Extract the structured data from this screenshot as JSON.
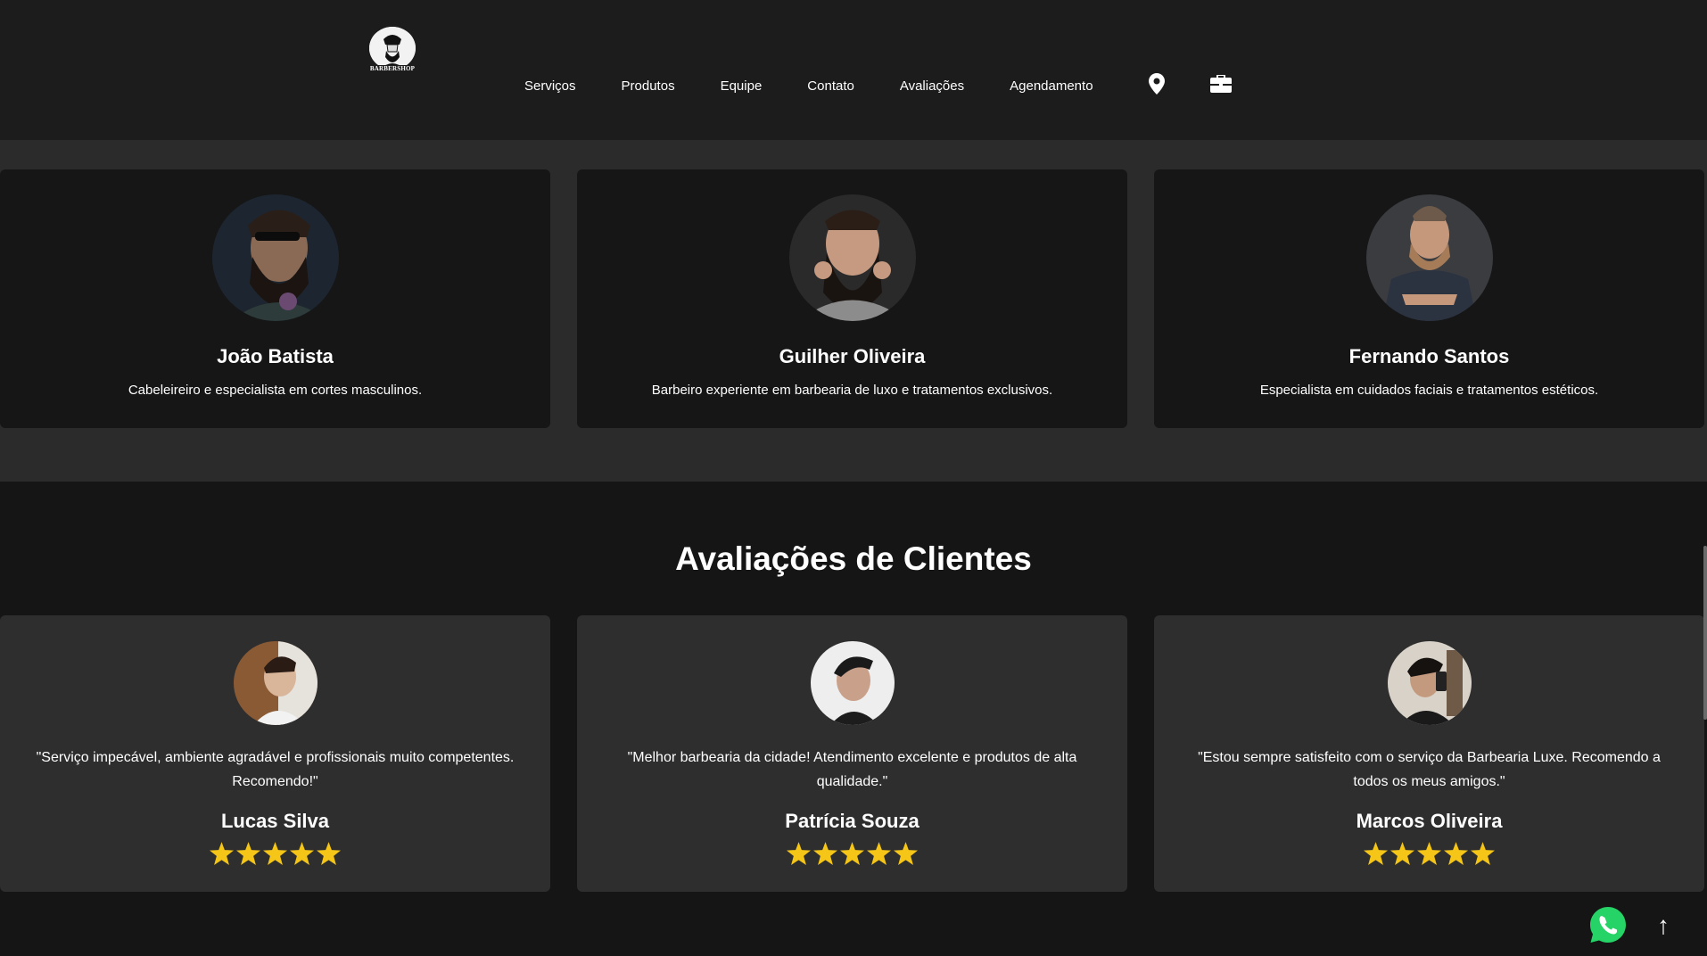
{
  "header": {
    "logo_text": "BARBERSHOP",
    "nav": [
      "Serviços",
      "Produtos",
      "Equipe",
      "Contato",
      "Avaliações",
      "Agendamento"
    ],
    "icons": [
      "map-marker-icon",
      "briefcase-icon"
    ]
  },
  "team": [
    {
      "name": "João Batista",
      "desc": "Cabeleireiro e especialista em cortes masculinos."
    },
    {
      "name": "Guilher Oliveira",
      "desc": "Barbeiro experiente em barbearia de luxo e tratamentos exclusivos."
    },
    {
      "name": "Fernando Santos",
      "desc": "Especialista em cuidados faciais e tratamentos estéticos."
    }
  ],
  "reviews": {
    "title": "Avaliações de Clientes",
    "items": [
      {
        "text": "\"Serviço impecável, ambiente agradável e profissionais muito competentes. Recomendo!\"",
        "name": "Lucas Silva",
        "rating": 5
      },
      {
        "text": "\"Melhor barbearia da cidade! Atendimento excelente e produtos de alta qualidade.\"",
        "name": "Patrícia Souza",
        "rating": 5
      },
      {
        "text": "\"Estou sempre satisfeito com o serviço da Barbearia Luxe. Recomendo a todos os meus amigos.\"",
        "name": "Marcos Oliveira",
        "rating": 5
      }
    ]
  },
  "floating": {
    "to_top": "↑"
  },
  "colors": {
    "star": "#f5c518",
    "whatsapp": "#25d366",
    "card": "#161616",
    "review_card": "#2e2e2e"
  }
}
